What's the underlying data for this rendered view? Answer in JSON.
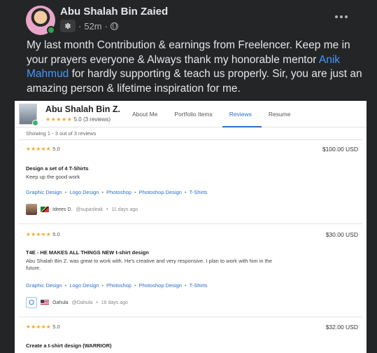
{
  "post": {
    "author": "Abu Shalah Bin Zaied",
    "time": "52m",
    "text_before_link": "My last month Contribution & earnings from Freelencer. Keep me in your prayers everyone & Always thank my honorable mentor ",
    "link_text": "Anik Mahmud",
    "text_after_link": " for hardly supporting & teach us properly. Sir, you are just an amazing person & lifetime inspiration for me."
  },
  "profile": {
    "name": "Abu Shalah Bin Z.",
    "stars": "★★★★★",
    "rating": "5.0 (3 reviews)",
    "tabs": [
      "About Me",
      "Portfolio Items",
      "Reviews",
      "Resume"
    ],
    "active_tab": "Reviews",
    "showing": "Showing 1 - 3 out of 3 reviews"
  },
  "reviews": [
    {
      "stars": "★★★★★",
      "score": "5.0",
      "price": "$100.00 USD",
      "title": "Design a set of 4 T-Shirts",
      "body": "Keep up the good work",
      "tags": [
        "Graphic Design",
        "Logo Design",
        "Photoshop",
        "Photoshop Design",
        "T-Shirts"
      ],
      "reviewer_name": "Idrees D.",
      "reviewer_handle": "@supasleak",
      "reviewer_time": "11 days ago",
      "avatar_letter": ""
    },
    {
      "stars": "★★★★★",
      "score": "5.0",
      "price": "$30.00 USD",
      "title": "T4E - HE MAKES ALL THINGS NEW t-shirt design",
      "body": "Abu Shalah Bin Z. was great to work with. He's creative and very responsive. I plan to work with him in the future.",
      "tags": [
        "Graphic Design",
        "Logo Design",
        "Photoshop",
        "Photoshop Design",
        "T-Shirts"
      ],
      "reviewer_name": "Oahula",
      "reviewer_handle": "@Oahula",
      "reviewer_time": "16 days ago",
      "avatar_letter": "O"
    },
    {
      "stars": "★★★★★",
      "score": "5.0",
      "price": "$32.00 USD",
      "title": "Create a t-shirt design (WARRIOR)"
    }
  ],
  "icons": {
    "group": "group-icon",
    "audience": "globe-icon",
    "more": "more-options-icon"
  },
  "colors": {
    "background": "#242526",
    "link": "#4599ff",
    "stars": "#f5a623",
    "tag": "#2a70c8"
  }
}
